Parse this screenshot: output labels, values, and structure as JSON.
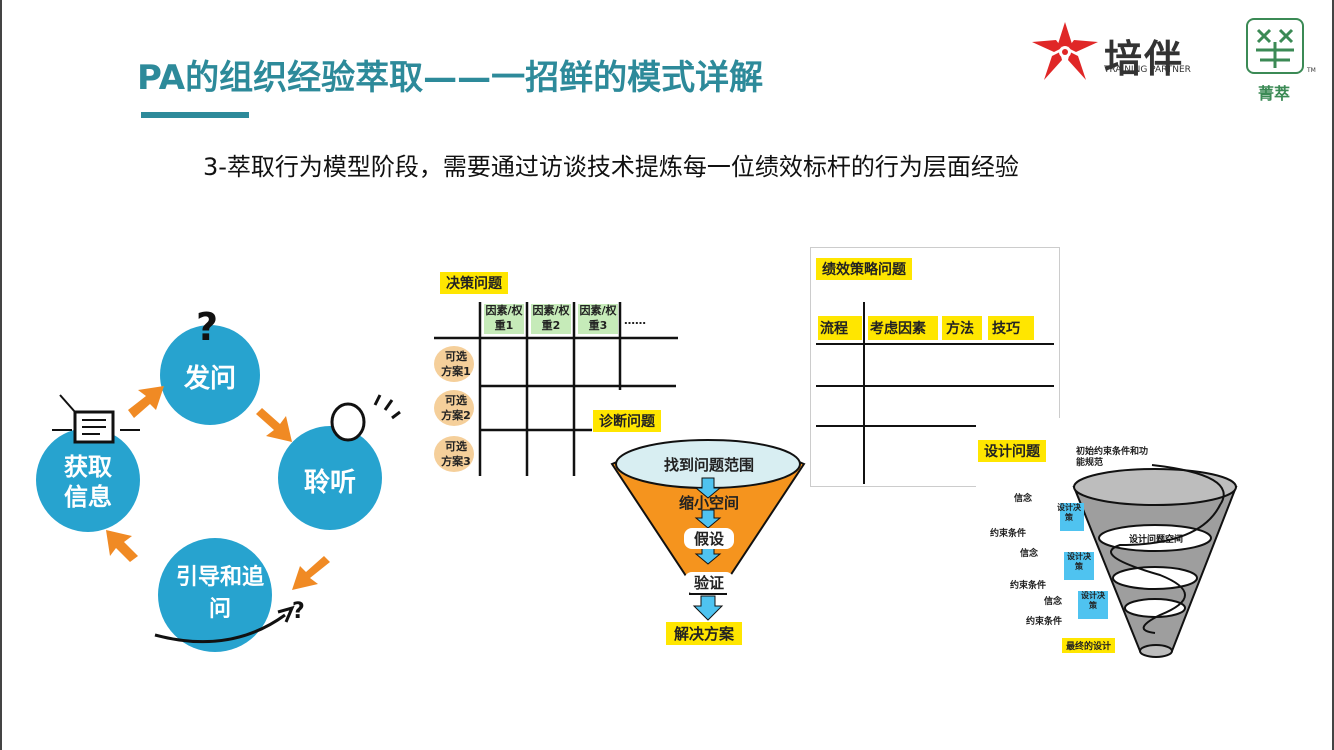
{
  "slide": {
    "title": "PA的组织经验萃取——一招鲜的模式详解",
    "subtitle": "3-萃取行为模型阶段，需要通过访谈技术提炼每一位绩效标杆的行为层面经验"
  },
  "logos": {
    "brand_name": "培伴",
    "brand_sub": "TRAINING PARTNER",
    "partner_name": "菁萃",
    "tm": "TM"
  },
  "cycle": {
    "nodes": [
      "发问",
      "聆听",
      "引导和追问",
      "获取信息"
    ],
    "accent": "#f08a24",
    "circle_color": "#27a3cf"
  },
  "decision": {
    "title": "决策问题",
    "headers": [
      "因素/权重1",
      "因素/权重2",
      "因素/权重3",
      "……"
    ],
    "rows": [
      "可选方案1",
      "可选方案2",
      "可选方案3"
    ]
  },
  "diagnosis": {
    "title": "诊断问题",
    "steps": [
      "找到问题范围",
      "缩小空间",
      "假设",
      "验证"
    ],
    "result": "解决方案"
  },
  "performance": {
    "title": "绩效策略问题",
    "headers": [
      "流程",
      "考虑因素",
      "方法",
      "技巧"
    ]
  },
  "design": {
    "title": "设计问题",
    "top_note": "初始约束条件和功能规范",
    "center": "设计问题空间",
    "left_labels": [
      "信念",
      "约束条件",
      "信念",
      "约束条件",
      "信念",
      "约束条件"
    ],
    "boxes": [
      "设计决策",
      "设计决策",
      "设计决策"
    ],
    "result": "最终的设计"
  },
  "colors": {
    "title": "#2d8a9a",
    "highlight": "#ffe600",
    "funnel_orange": "#f5941e",
    "arrow_blue": "#4fc3f0"
  }
}
